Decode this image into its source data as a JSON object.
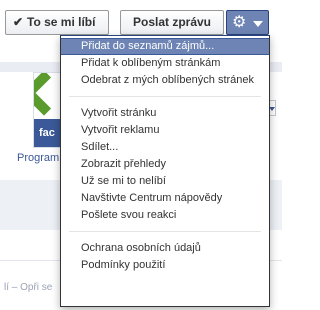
{
  "header": {
    "like_button_label": "To se mi líbí",
    "message_button_label": "Poslat zprávu",
    "gear_icon": "gear-icon",
    "like_icon": "check-icon"
  },
  "background": {
    "program_link": "Program",
    "footer_text": "lí – Opři se"
  },
  "menu": {
    "group1": [
      "Přidat do seznamů zájmů...",
      "Přidat k oblíbeným stránkám",
      "Odebrat z mých oblíbených stránek"
    ],
    "group2": [
      "Vytvořit stránku",
      "Vytvořit reklamu",
      "Sdílet...",
      "Zobrazit přehledy",
      "Už se mi to nelíbí",
      "Navštivte Centrum nápovědy",
      "Pošlete svou reakci"
    ],
    "group3": [
      "Ochrana osobních údajů",
      "Podmínky použití"
    ]
  },
  "colors": {
    "highlight": "#6d84b4",
    "brand": "#3b5998",
    "logo_green": "#5b9a2c"
  }
}
